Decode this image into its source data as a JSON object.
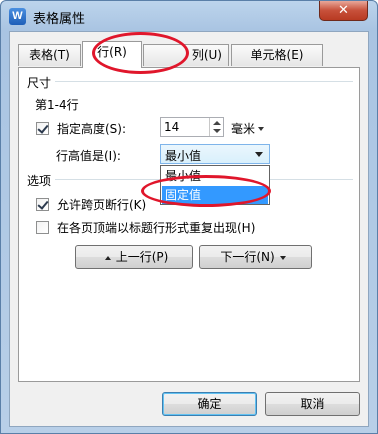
{
  "window": {
    "title": "表格属性",
    "icon": "W",
    "close_glyph": "✕"
  },
  "tabs": [
    {
      "label": "表格(T)"
    },
    {
      "label": "行(R)"
    },
    {
      "label": "列(U)"
    },
    {
      "label": "单元格(E)"
    }
  ],
  "size_section": {
    "title": "尺寸",
    "rows_label": "第1-4行",
    "specify_height": {
      "label": "指定高度(S):",
      "checked": true
    },
    "height_value": "14",
    "unit": "毫米",
    "height_is_label": "行高值是(I):",
    "height_is_selected": "最小值",
    "height_is_options": [
      "最小值",
      "固定值"
    ]
  },
  "options_section": {
    "title": "选项",
    "allow_break": {
      "label": "允许跨页断行(K)",
      "checked": true
    },
    "repeat_header": {
      "label": "在各页顶端以标题行形式重复出现(H)",
      "checked": false
    }
  },
  "nav": {
    "prev_label": "上一行(P)",
    "next_label": "下一行(N)"
  },
  "footer": {
    "ok_label": "确定",
    "cancel_label": "取消"
  },
  "colors": {
    "annotation": "#e0162b",
    "highlight": "#3399ff",
    "title_bg": "#a9c4e2"
  }
}
